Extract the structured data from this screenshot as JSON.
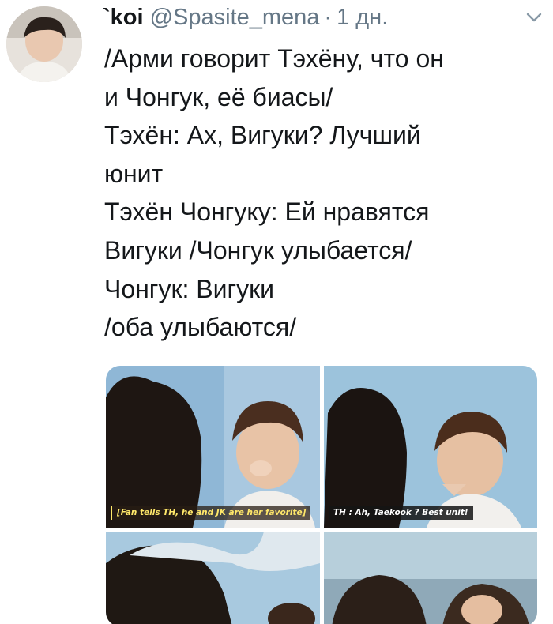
{
  "tweet": {
    "author": {
      "display_name": "`koi",
      "handle": "@Spasite_mena",
      "separator": "·",
      "time": "1 дн."
    },
    "text_lines": [
      "/Арми говорит Тэхёну, что он",
      "и Чонгук, её биасы/",
      "Тэхён: Ах, Вигуки? Лучший",
      "юнит",
      "Тэхён Чонгуку: Ей нравятся",
      "Вигуки /Чонгук улыбается/",
      "Чонгук: Вигуки",
      "/оба улыбаются/"
    ],
    "media": [
      {
        "caption": "[Fan tells TH, he and JK are her favorite]"
      },
      {
        "caption": "TH : Ah, Taekook ? Best unit!"
      },
      {
        "caption": ""
      },
      {
        "caption": ""
      }
    ]
  },
  "icons": {
    "more_menu": "chevron-down-icon",
    "avatar": "profile-photo"
  },
  "colors": {
    "primary_text": "#14171a",
    "secondary_text": "#657786",
    "background": "#ffffff"
  }
}
